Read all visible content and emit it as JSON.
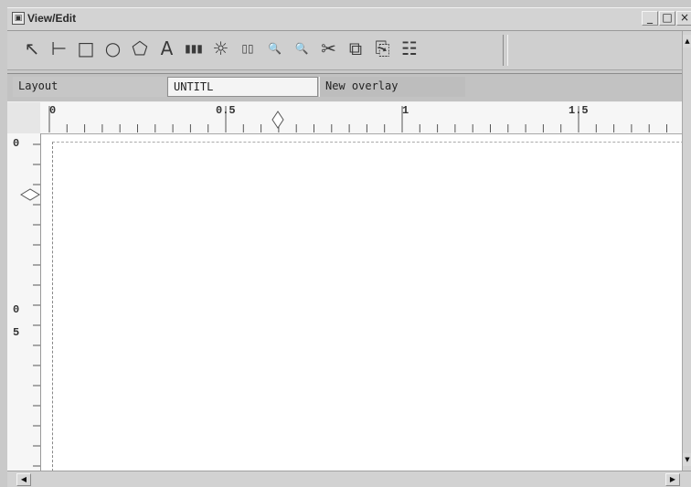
{
  "window": {
    "title": "View/Edit",
    "minimize_label": "_",
    "maximize_label": "□",
    "close_label": "×"
  },
  "toolbar": {
    "tools": [
      {
        "name": "select-tool",
        "glyph": "↖"
      },
      {
        "name": "line-tool",
        "glyph": "⊢"
      },
      {
        "name": "rectangle-tool",
        "glyph": "□"
      },
      {
        "name": "ellipse-tool",
        "glyph": "○"
      },
      {
        "name": "polygon-tool",
        "glyph": "⬠"
      },
      {
        "name": "text-tool",
        "glyph": "A"
      },
      {
        "name": "barcode-tool",
        "glyph": "▮▮▮"
      },
      {
        "name": "image-tool",
        "glyph": "☼"
      },
      {
        "name": "field-tool",
        "glyph": "▯▯"
      },
      {
        "name": "zoom-in-tool",
        "glyph": "🔍"
      },
      {
        "name": "zoom-out-tool",
        "glyph": "🔍"
      },
      {
        "name": "cut-tool",
        "glyph": "✂"
      },
      {
        "name": "copy-tool",
        "glyph": "⧉"
      },
      {
        "name": "paste-tool",
        "glyph": "⎘"
      },
      {
        "name": "properties-tool",
        "glyph": "☷"
      }
    ]
  },
  "status": {
    "layout_label": "Layout",
    "layout_name": "UNTITL",
    "overlay_label": "New overlay"
  },
  "ruler_h": {
    "labels": [
      "0",
      "0.5",
      "1",
      "1.5"
    ]
  },
  "ruler_v": {
    "labels": [
      "0",
      "0",
      "5"
    ]
  },
  "scroll": {
    "left_arrow": "◀",
    "right_arrow": "▶",
    "up_arrow": "▲",
    "down_arrow": "▼"
  }
}
